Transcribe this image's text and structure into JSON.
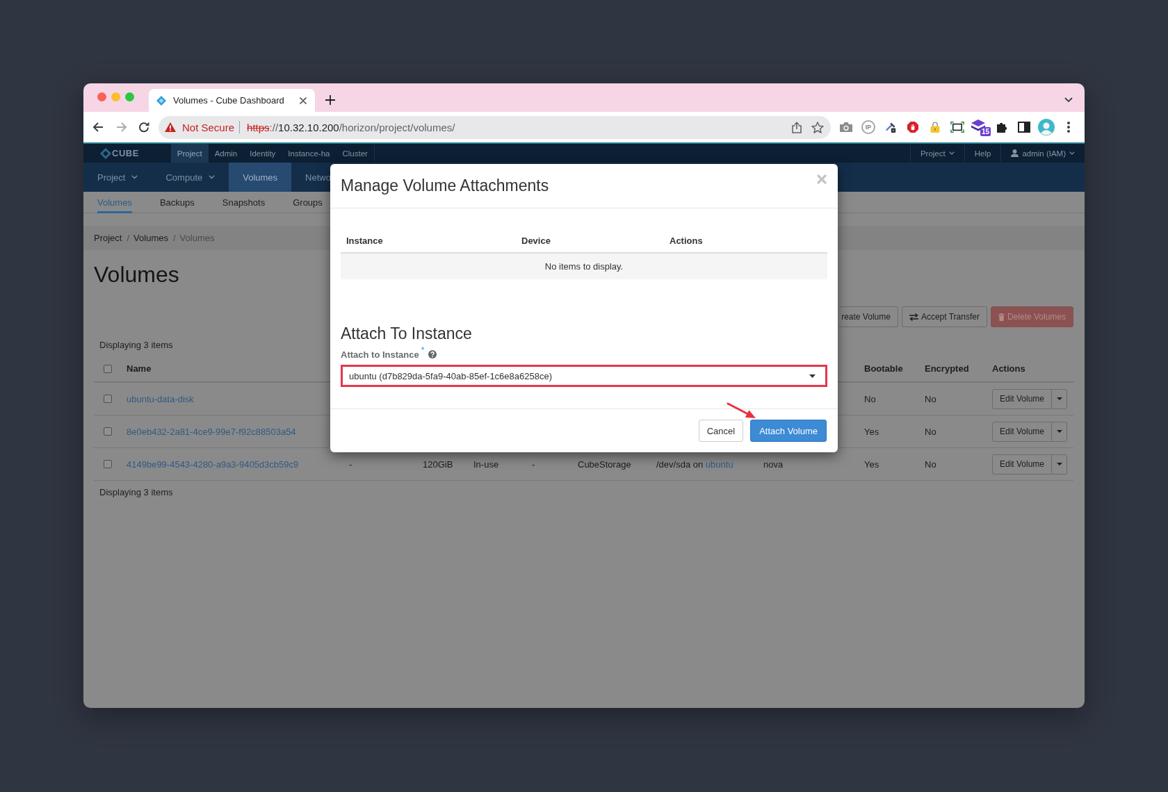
{
  "browser": {
    "tab": {
      "title": "Volumes - Cube Dashboard",
      "selected": true
    },
    "navigation": {
      "back_disabled": false,
      "forward_disabled": true
    },
    "address_bar": {
      "security_label": "Not Secure",
      "scheme": "https",
      "separator": "://",
      "host": "10.32.10.200",
      "path": "/horizon/project/volumes/"
    },
    "ip_extension": "IP",
    "extension_badge": "15"
  },
  "top_nav": {
    "logo": "CUBE",
    "tabs": [
      {
        "label": "Project",
        "selected": true
      },
      {
        "label": "Admin",
        "selected": false
      },
      {
        "label": "Identity",
        "selected": false
      },
      {
        "label": "Instance-ha",
        "selected": false
      },
      {
        "label": "Cluster",
        "selected": false
      }
    ],
    "menus": [
      {
        "kind": "dropdown",
        "label": "Project"
      },
      {
        "kind": "link",
        "label": "Help"
      },
      {
        "kind": "user",
        "label": "admin (IAM)"
      }
    ]
  },
  "main_nav": {
    "items": [
      {
        "label": "Project",
        "dropdown": true,
        "selected": false
      },
      {
        "label": "Compute",
        "dropdown": true,
        "selected": false
      },
      {
        "label": "Volumes",
        "dropdown": false,
        "selected": true
      },
      {
        "label": "Netwo",
        "dropdown": false,
        "selected": false
      }
    ]
  },
  "sub_tabs": [
    {
      "label": "Volumes",
      "selected": true
    },
    {
      "label": "Backups",
      "selected": false
    },
    {
      "label": "Snapshots",
      "selected": false
    },
    {
      "label": "Groups",
      "selected": false
    }
  ],
  "breadcrumb": {
    "separator": "/",
    "items": [
      {
        "label": "Project",
        "current": false
      },
      {
        "label": "Volumes",
        "current": false
      },
      {
        "label": "Volumes",
        "current": true
      }
    ]
  },
  "page_title": "Volumes",
  "actions": [
    {
      "label": "reate Volume",
      "kind": "default",
      "disabled": false
    },
    {
      "label": "Accept Transfer",
      "kind": "transfer",
      "disabled": false
    },
    {
      "label": "Delete Volumes",
      "kind": "delete",
      "disabled": true
    }
  ],
  "table": {
    "summary": "Displaying 3 items",
    "all_checked": false,
    "columns": [
      "Name",
      "Bootable",
      "Encrypted",
      "Actions"
    ],
    "rows": [
      {
        "checked": false,
        "name": "ubuntu-data-disk",
        "bootable": "No",
        "encrypted": "No",
        "action": "Edit Volume"
      },
      {
        "checked": false,
        "name": "8e0eb432-2a81-4ce9-99e7-f92c88503a54",
        "bootable": "Yes",
        "encrypted": "No",
        "action": "Edit Volume"
      },
      {
        "checked": false,
        "name": "4149be99-4543-4280-a9a3-9405d3cb59c9",
        "cells": [
          {
            "text": "-"
          },
          {
            "text": "120GiB"
          },
          {
            "text": "In-use"
          },
          {
            "text": "-"
          },
          {
            "text": "CubeStorage"
          },
          {
            "text": "/dev/sda on",
            "link": "ubuntu"
          },
          {
            "text": "nova"
          }
        ],
        "bootable": "Yes",
        "encrypted": "No",
        "action": "Edit Volume"
      }
    ],
    "footer_summary": "Displaying 3 items"
  },
  "modal": {
    "title": "Manage Volume Attachments",
    "attachments": {
      "columns": [
        "Instance",
        "Device",
        "Actions"
      ],
      "empty_text": "No items to display."
    },
    "attach": {
      "heading": "Attach To Instance",
      "label": "Attach to Instance",
      "required_mark": "*",
      "field": {
        "value": "ubuntu (d7b829da-5fa9-40ab-85ef-1c6e8a6258ce)",
        "highlighted": true
      }
    },
    "buttons": [
      {
        "label": "Cancel",
        "kind": "default",
        "annotated": false
      },
      {
        "label": "Attach Volume",
        "kind": "primary",
        "annotated": true
      }
    ]
  }
}
